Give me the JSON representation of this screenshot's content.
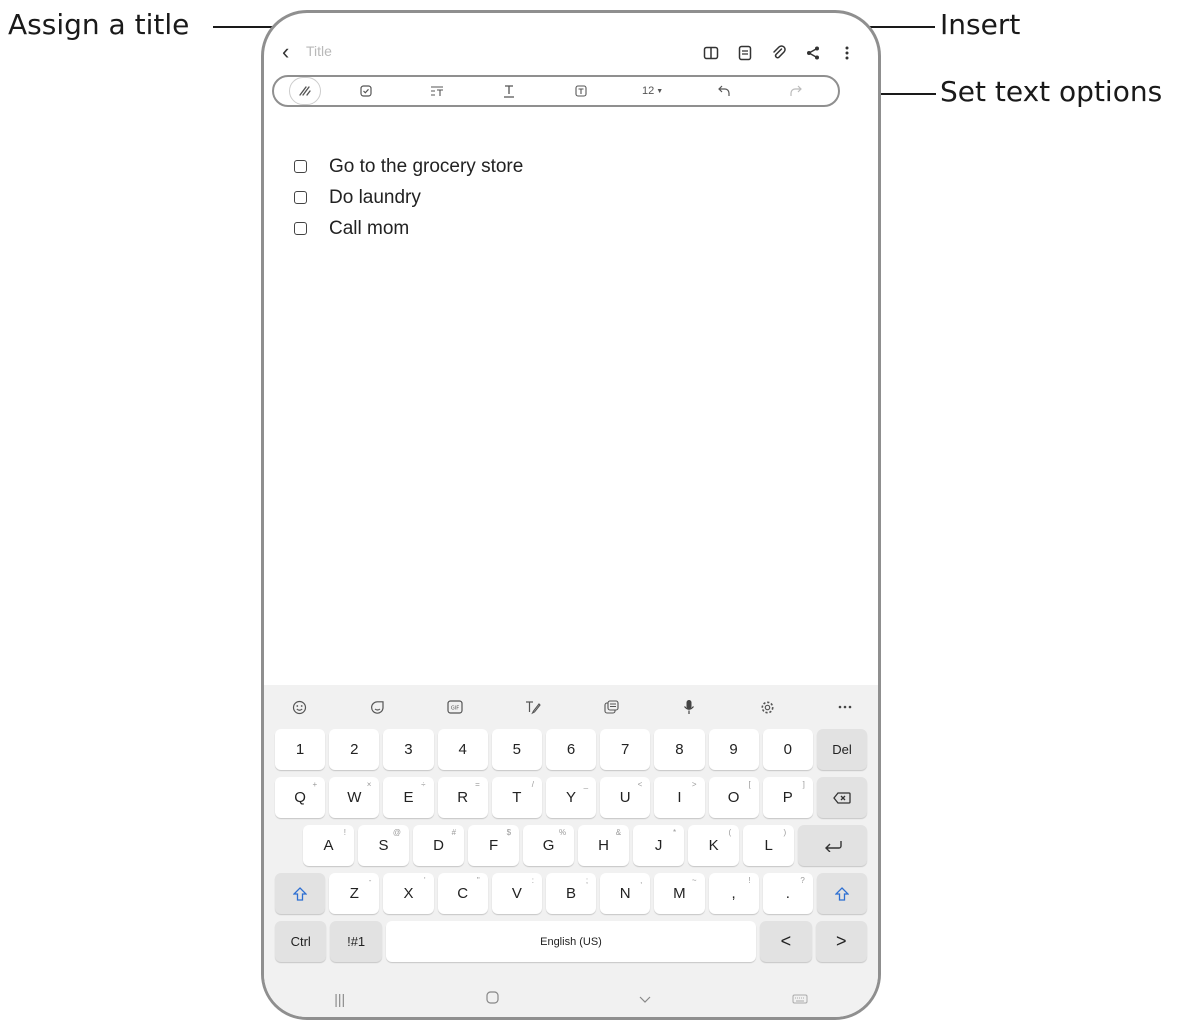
{
  "callouts": {
    "assign_title": "Assign a title",
    "insert": "Insert",
    "set_text_options": "Set text options"
  },
  "app": {
    "title_placeholder": "Title",
    "font_size": "12",
    "top_icons": [
      "book-icon",
      "page-icon",
      "attach-icon",
      "share-icon",
      "more-icon"
    ],
    "toolbar_icons": [
      "pen-icon",
      "checkbox-icon",
      "paragraph-icon",
      "text-style-icon",
      "text-box-icon",
      "font-size-dropdown",
      "undo-icon",
      "redo-icon"
    ]
  },
  "tasks": [
    {
      "label": "Go to the grocery store",
      "checked": false
    },
    {
      "label": "Do laundry",
      "checked": false
    },
    {
      "label": "Call mom",
      "checked": false
    }
  ],
  "keyboard": {
    "toolbar": [
      "emoji-icon",
      "sticker-icon",
      "gif-icon",
      "handwriting-icon",
      "clipboard-icon",
      "mic-icon",
      "settings-icon",
      "more-icon"
    ],
    "row_numbers": [
      "1",
      "2",
      "3",
      "4",
      "5",
      "6",
      "7",
      "8",
      "9",
      "0",
      "Del"
    ],
    "row_qwerty": [
      {
        "k": "Q",
        "s": "+"
      },
      {
        "k": "W",
        "s": "×"
      },
      {
        "k": "E",
        "s": "÷"
      },
      {
        "k": "R",
        "s": "="
      },
      {
        "k": "T",
        "s": "/"
      },
      {
        "k": "Y",
        "s": "_"
      },
      {
        "k": "U",
        "s": "<"
      },
      {
        "k": "I",
        "s": ">"
      },
      {
        "k": "O",
        "s": "["
      },
      {
        "k": "P",
        "s": "]"
      }
    ],
    "row_asdf": [
      {
        "k": "A",
        "s": "!"
      },
      {
        "k": "S",
        "s": "@"
      },
      {
        "k": "D",
        "s": "#"
      },
      {
        "k": "F",
        "s": "$"
      },
      {
        "k": "G",
        "s": "%"
      },
      {
        "k": "H",
        "s": "&"
      },
      {
        "k": "J",
        "s": "*"
      },
      {
        "k": "K",
        "s": "("
      },
      {
        "k": "L",
        "s": ")"
      }
    ],
    "row_zxcv": [
      {
        "k": "Z",
        "s": "-"
      },
      {
        "k": "X",
        "s": "'"
      },
      {
        "k": "C",
        "s": "\""
      },
      {
        "k": "V",
        "s": ":"
      },
      {
        "k": "B",
        "s": ";"
      },
      {
        "k": "N",
        "s": ","
      },
      {
        "k": "M",
        "s": "~"
      },
      {
        "k": ",",
        "s": "!"
      },
      {
        "k": ".",
        "s": "?"
      }
    ],
    "ctrl": "Ctrl",
    "symbols": "!#1",
    "space": "English (US)",
    "left": "<",
    "right": ">"
  }
}
